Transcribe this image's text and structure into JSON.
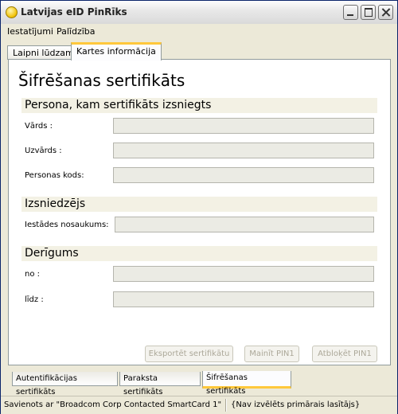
{
  "window": {
    "title": "Latvijas eID PinRīks"
  },
  "menu": {
    "items": [
      "Iestatījumi",
      "Palīdzība"
    ]
  },
  "tabs": {
    "top": [
      "Laipni lūdzam!",
      "Kartes informācija"
    ],
    "active_top": "Kartes informācija"
  },
  "page": {
    "title": "Šifrēšanas sertifikāts",
    "sections": {
      "persona": {
        "header": "Persona, kam sertifikāts izsniegts",
        "fields": {
          "vards": "Vārds :",
          "uzvards": "Uzvārds :",
          "personas_kods": "Personas kods:"
        }
      },
      "izsniedzejs": {
        "header": "Izsniedzējs",
        "fields": {
          "iestades_nosaukums": "Iestādes nosaukums:"
        }
      },
      "derigums": {
        "header": "Derīgums",
        "fields": {
          "no": "no :",
          "lidz": "līdz :"
        }
      }
    },
    "buttons": {
      "export": "Eksportēt sertifikātu",
      "change_pin": "Mainīt PIN1",
      "unblock_pin": "Atbloķēt PIN1"
    }
  },
  "bottom_tabs": [
    "Autentifikācijas sertifikāts",
    "Paraksta sertifikāts",
    "Šifrēšanas sertifikāts"
  ],
  "status": {
    "left": "Savienots ar \"Broadcom Corp Contacted SmartCard 1\"",
    "right": "{Nav izvēlēts primārais lasītājs}"
  }
}
